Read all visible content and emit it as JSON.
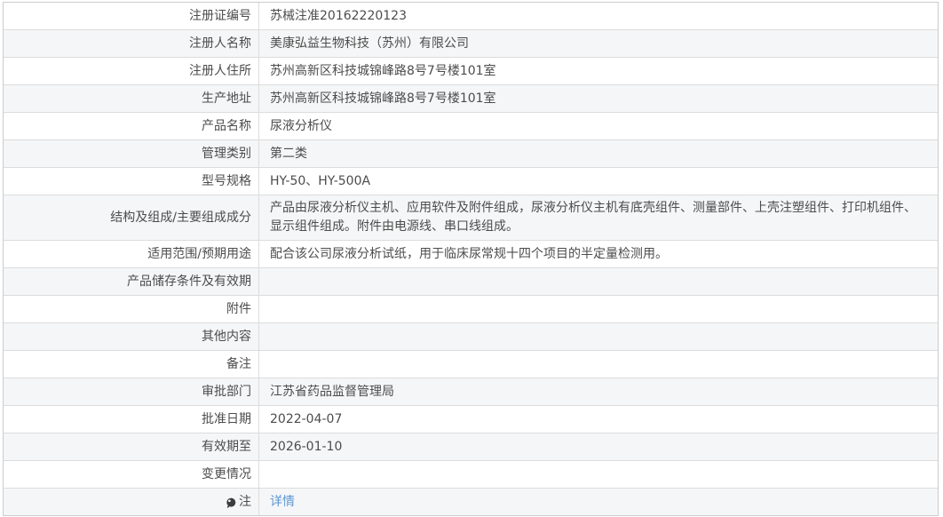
{
  "colors": {
    "link": "#5e97d3",
    "row_alt_bg": "#f5f6f7",
    "border": "#dcdcdc",
    "text": "#4c4c4c"
  },
  "table": {
    "rows": [
      {
        "label": "注册证编号",
        "value": "苏械注准20162220123"
      },
      {
        "label": "注册人名称",
        "value": "美康弘益生物科技（苏州）有限公司"
      },
      {
        "label": "注册人住所",
        "value": "苏州高新区科技城锦峰路8号7号楼101室"
      },
      {
        "label": "生产地址",
        "value": "苏州高新区科技城锦峰路8号7号楼101室"
      },
      {
        "label": "产品名称",
        "value": "尿液分析仪"
      },
      {
        "label": "管理类别",
        "value": "第二类"
      },
      {
        "label": "型号规格",
        "value": "HY-50、HY-500A"
      },
      {
        "label": "结构及组成/主要组成成分",
        "value": "产品由尿液分析仪主机、应用软件及附件组成，尿液分析仪主机有底壳组件、测量部件、上壳注塑组件、打印机组件、显示组件组成。附件由电源线、串口线组成。"
      },
      {
        "label": "适用范围/预期用途",
        "value": "配合该公司尿液分析试纸，用于临床尿常规十四个项目的半定量检测用。"
      },
      {
        "label": "产品储存条件及有效期",
        "value": ""
      },
      {
        "label": "附件",
        "value": ""
      },
      {
        "label": "其他内容",
        "value": ""
      },
      {
        "label": "备注",
        "value": ""
      },
      {
        "label": "审批部门",
        "value": "江苏省药品监督管理局"
      },
      {
        "label": "批准日期",
        "value": "2022-04-07"
      },
      {
        "label": "有效期至",
        "value": "2026-01-10"
      },
      {
        "label": "变更情况",
        "value": ""
      },
      {
        "label": "注",
        "icon": "bulb-icon",
        "link_text": "详情"
      }
    ]
  }
}
